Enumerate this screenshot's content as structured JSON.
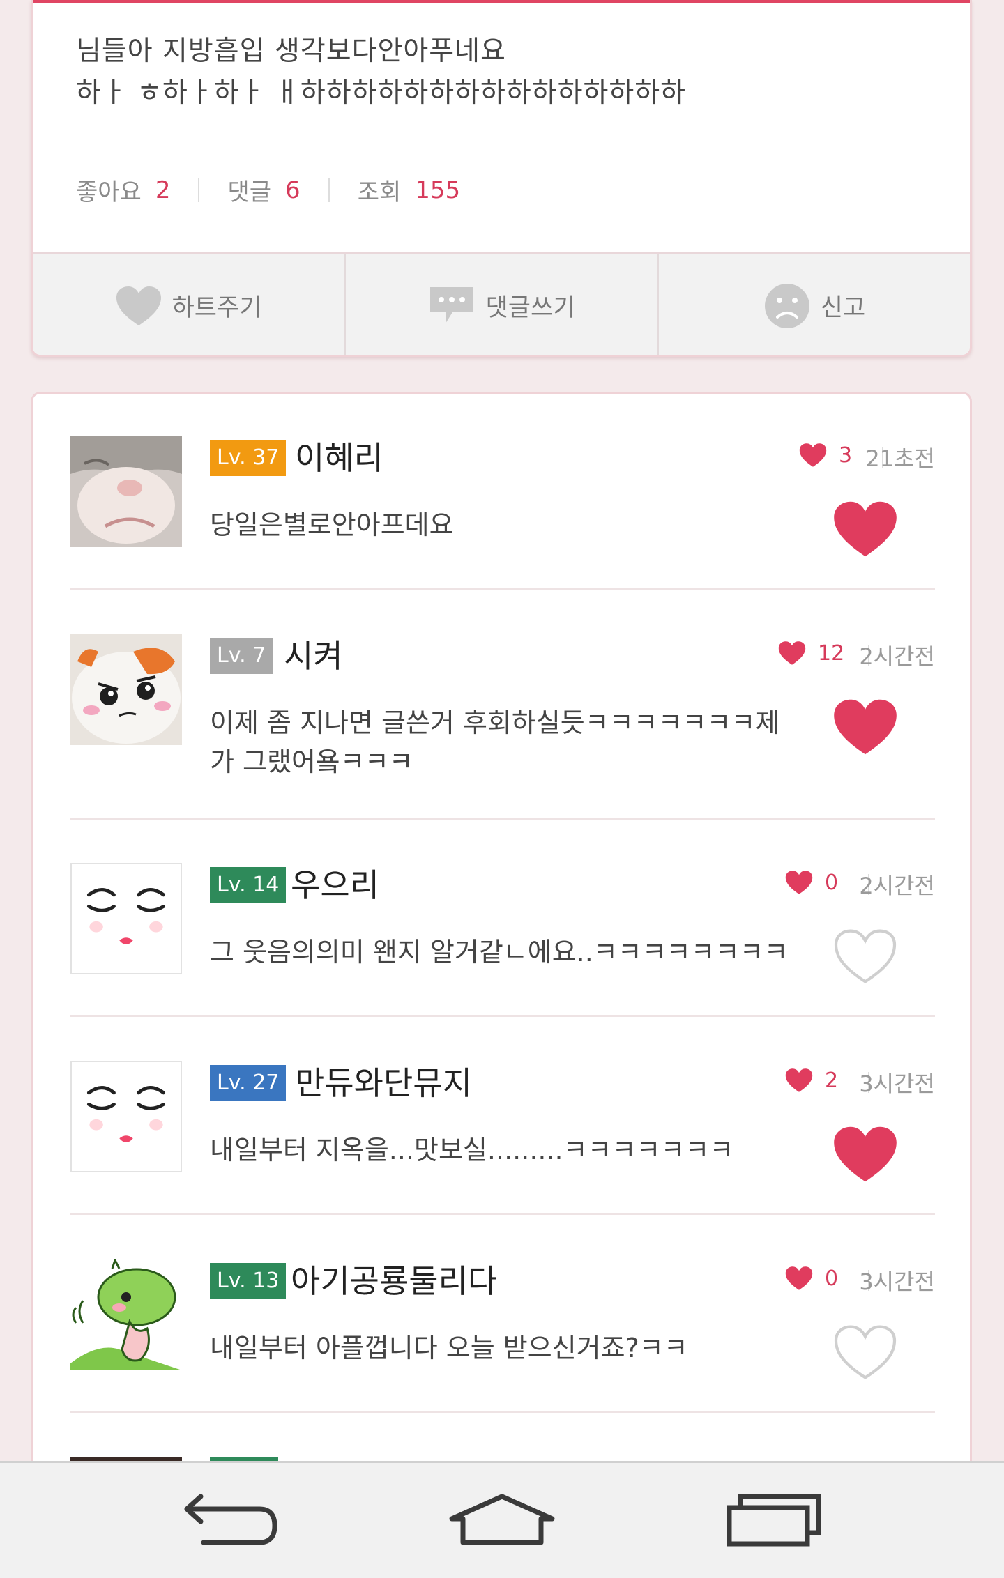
{
  "post": {
    "body_lines": [
      "님들아 지방흡입 생각보다안아푸네요",
      "하ㅏ ㅎ하ㅏ하ㅏ ㅐ하하하하하하하하하하하하하하하"
    ],
    "stats": [
      {
        "label": "좋아요",
        "value": "2"
      },
      {
        "label": "댓글",
        "value": "6"
      },
      {
        "label": "조회",
        "value": "155"
      }
    ],
    "actions": [
      {
        "label": "하트주기",
        "icon": "heart-icon"
      },
      {
        "label": "댓글쓰기",
        "icon": "comment-bubble-icon"
      },
      {
        "label": "신고",
        "icon": "sad-face-icon"
      }
    ]
  },
  "comments": [
    {
      "level": "Lv. 37",
      "level_color": "#f29a11",
      "nickname": "이혜리",
      "likes": "3",
      "time": "21초전",
      "text": "당일은별로안아프데요",
      "liked": true,
      "avatar": "cat-face-photo"
    },
    {
      "level": "Lv. 7",
      "level_color": "#a9a9a9",
      "nickname": "시켜",
      "likes": "12",
      "time": "2시간전",
      "text": "이제 좀 지나면 글쓴거 후회하실듯ㅋㅋㅋㅋㅋㅋㅋ제가 그랬어욬ㅋㅋㅋ",
      "liked": true,
      "avatar": "hamster-plush"
    },
    {
      "level": "Lv. 14",
      "level_color": "#2e8a5a",
      "nickname": "우으리",
      "likes": "0",
      "time": "2시간전",
      "text": "그 웃음의의미 왠지 알거같ㄴ에요..ㅋㅋㅋㅋㅋㅋㅋㅋ",
      "liked": false,
      "avatar": "sleepy-face"
    },
    {
      "level": "Lv. 27",
      "level_color": "#3a76c0",
      "nickname": "만듀와단뮤지",
      "likes": "2",
      "time": "3시간전",
      "text": "내일부터 지옥을...맛보실.........ㅋㅋㅋㅋㅋㅋㅋ",
      "liked": true,
      "avatar": "sleepy-face"
    },
    {
      "level": "Lv. 13",
      "level_color": "#2e8a5a",
      "nickname": "아기공룡둘리다",
      "likes": "0",
      "time": "3시간전",
      "text": "내일부터 아플껍니다 오늘 받으신거죠?ㅋㅋ",
      "liked": false,
      "avatar": "green-dino"
    }
  ],
  "colors": {
    "accent": "#e04563",
    "heart": "#e03c5e"
  }
}
